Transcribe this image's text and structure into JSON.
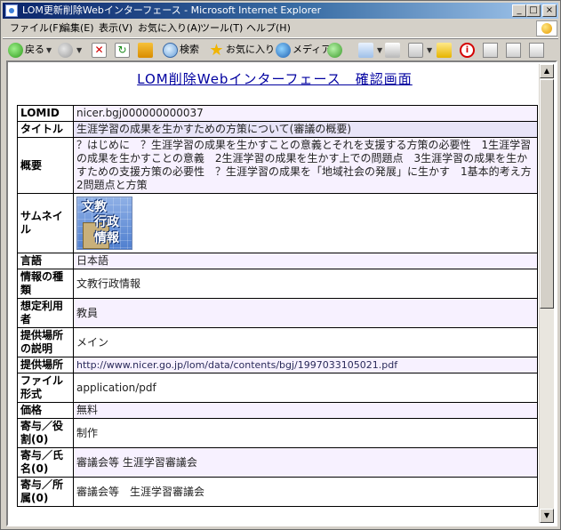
{
  "window": {
    "title": "LOM更新削除Webインターフェース - Microsoft Internet Explorer",
    "controls": [
      "_",
      "□",
      "×"
    ]
  },
  "menu": [
    "ファイル(F)",
    "編集(E)",
    "表示(V)",
    "お気に入り(A)",
    "ツール(T)",
    "ヘルプ(H)"
  ],
  "toolbar": {
    "back": "戻る",
    "search": "検索",
    "favorites": "お気に入り",
    "media": "メディア"
  },
  "page": {
    "heading": "LOM削除Webインターフェース　確認画面",
    "thumbnail_text": [
      "文教",
      "行政",
      "情報"
    ],
    "rows": [
      {
        "label": "LOMID",
        "value": "nicer.bgj000000000037"
      },
      {
        "label": "タイトル",
        "value": "生涯学習の成果を生かすための方策について(審議の概要)"
      },
      {
        "label": "概要",
        "value": "？はじめに　？生涯学習の成果を生かすことの意義とそれを支援する方策の必要性　1生涯学習の成果を生かすことの意義　2生涯学習の成果を生かす上での問題点　3生涯学習の成果を生かすための支援方策の必要性　？生涯学習の成果を「地域社会の発展」に生かす　1基本的考え方　2問題点と方策"
      },
      {
        "label": "サムネイル",
        "value": ""
      },
      {
        "label": "言語",
        "value": "日本語"
      },
      {
        "label": "情報の種類",
        "value": "文教行政情報"
      },
      {
        "label": "想定利用者",
        "value": "教員"
      },
      {
        "label": "提供場所の説明",
        "value": "メイン"
      },
      {
        "label": "提供場所",
        "value": "http://www.nicer.go.jp/lom/data/contents/bgj/1997033105021.pdf"
      },
      {
        "label": "ファイル形式",
        "value": "application/pdf"
      },
      {
        "label": "価格",
        "value": "無料"
      },
      {
        "label": "寄与／役割(0)",
        "value": "制作"
      },
      {
        "label": "寄与／氏名(0)",
        "value": "審議会等 生涯学習審議会"
      },
      {
        "label": "寄与／所属(0)",
        "value": "審議会等　生涯学習審議会"
      }
    ]
  }
}
